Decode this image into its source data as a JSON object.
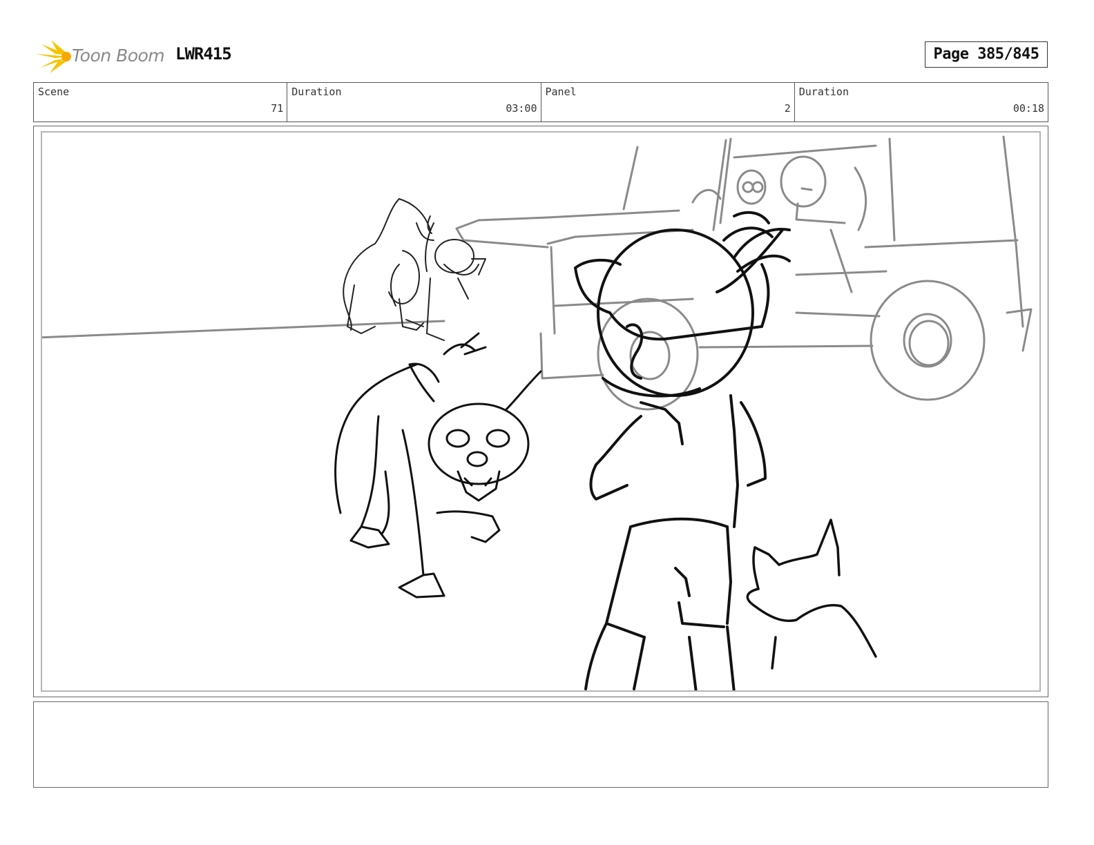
{
  "header": {
    "logo_text": "Toon Boom",
    "project_code": "LWR415",
    "page": "Page 385/845"
  },
  "info": {
    "scene_label": "Scene",
    "scene_value": "71",
    "scene_duration_label": "Duration",
    "scene_duration_value": "03:00",
    "panel_label": "Panel",
    "panel_value": "2",
    "panel_duration_label": "Duration",
    "panel_duration_value": "00:18"
  },
  "notes": {
    "text": ""
  },
  "colors": {
    "logo_accent": "#f5c400",
    "sketch_dark": "#111111",
    "sketch_light": "#8a8a8a"
  }
}
